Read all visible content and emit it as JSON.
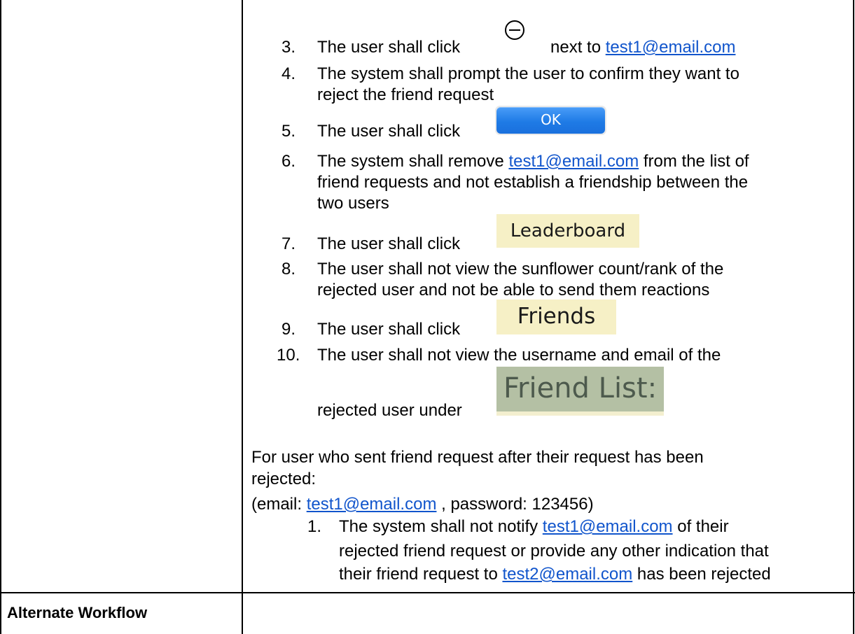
{
  "steps": [
    {
      "num": "3.",
      "pre": "The user shall click",
      "post": "next to",
      "link": "test1@email.com"
    },
    {
      "num": "4.",
      "line1": "The system shall prompt the user to confirm they want to",
      "line2": "reject the friend request"
    },
    {
      "num": "5.",
      "pre": "The user shall click",
      "button": "OK"
    },
    {
      "num": "6.",
      "pre": "The system shall remove",
      "link": "test1@email.com",
      "post": "from the list of",
      "line2": "friend requests and not establish a friendship between the",
      "line3": "two users"
    },
    {
      "num": "7.",
      "pre": "The user shall click",
      "tag": "Leaderboard"
    },
    {
      "num": "8.",
      "line1": "The user shall not view the sunflower count/rank of the",
      "line2": "rejected user and not be able to send them reactions"
    },
    {
      "num": "9.",
      "pre": "The user shall click",
      "tag": "Friends"
    },
    {
      "num": "10.",
      "line1": "The user shall not view the username and email of the",
      "line2": "rejected user under",
      "tag": "Friend List:"
    }
  ],
  "sender_section": {
    "intro_line1": "For user who sent friend request after their request has been",
    "intro_line2": "rejected:",
    "creds_pre": "(email: ",
    "creds_link": "test1@email.com",
    "creds_post": " , password: 123456)",
    "step": {
      "num": "1.",
      "line1_pre": "The system shall not notify",
      "line1_link": "test1@email.com",
      "line1_post": "of their",
      "line2": "rejected friend request or provide any other indication that",
      "line3_pre": "their friend request to",
      "line3_link": "test2@email.com",
      "line3_post": "has been rejected"
    }
  },
  "alternate_workflow_label": "Alternate Workflow",
  "colors": {
    "link": "#1155cc",
    "ok_button": "#1f7be6",
    "tag_bg": "#f6f0c6",
    "friend_list_bg": "#b4c0a4"
  }
}
